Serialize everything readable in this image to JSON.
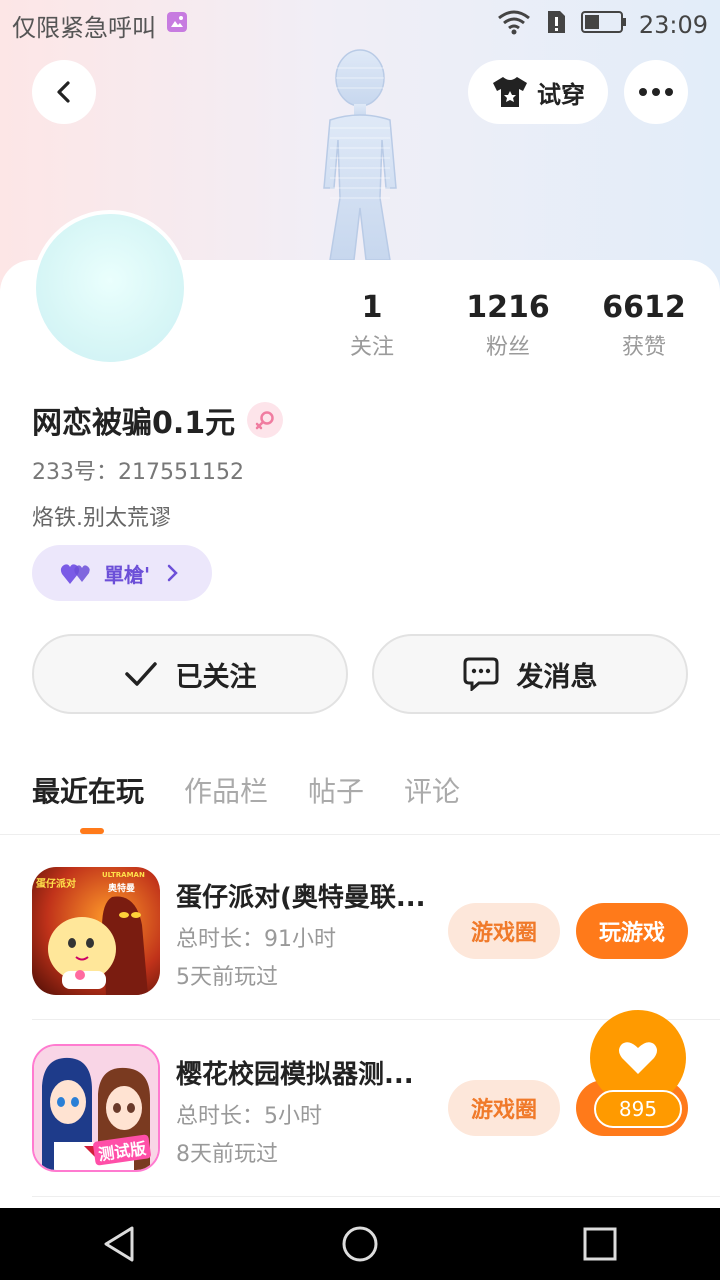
{
  "status_bar": {
    "carrier_text": "仅限紧急呼叫",
    "time": "23:09"
  },
  "header": {
    "back_icon": "chevron-left-icon",
    "try_on_label": "试穿",
    "more_icon": "more-dots-icon"
  },
  "profile": {
    "stats": [
      {
        "value": "1",
        "label": "关注"
      },
      {
        "value": "1216",
        "label": "粉丝"
      },
      {
        "value": "6612",
        "label": "获赞"
      }
    ],
    "nickname": "网恋被骗0.1元",
    "gender_icon": "female-icon",
    "uid": "233号：217551152",
    "signature": "烙铁.别太荒谬",
    "tag_label": "單槍'"
  },
  "actions": {
    "followed_label": "已关注",
    "message_label": "发消息"
  },
  "tabs": [
    "最近在玩",
    "作品栏",
    "帖子",
    "评论"
  ],
  "games": [
    {
      "title": "蛋仔派对(奥特曼联...",
      "duration": "总时长：91小时",
      "last_played": "5天前玩过",
      "circle_label": "游戏圈",
      "play_label": "玩游戏",
      "icon_text_top": "ULTRAMAN",
      "icon_text_brand": "蛋仔派对",
      "icon_text_sub": "奥特曼"
    },
    {
      "title": "樱花校园模拟器测...",
      "duration": "总时长：5小时",
      "last_played": "8天前玩过",
      "circle_label": "游戏圈",
      "icon_text_badge": "测试版"
    }
  ],
  "floating_like": {
    "icon": "heart-icon",
    "count": "895"
  },
  "colors": {
    "accent_orange": "#ff7a1a",
    "tag_purple": "#6c4fd8",
    "circle_btn_bg": "#fde7da"
  }
}
